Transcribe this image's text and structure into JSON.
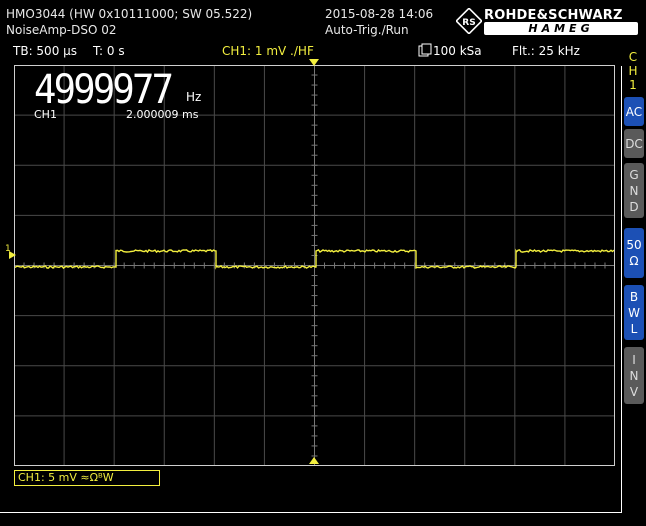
{
  "header": {
    "model": "HMO3044 (HW 0x10111000; SW 05.522)",
    "name": "NoiseAmp-DSO 02",
    "datetime": "2015-08-28 14:06",
    "trigger_mode": "Auto-Trig./Run",
    "brand": "ROHDE&SCHWARZ",
    "sub_brand": "HAMEG"
  },
  "status": {
    "timebase": "TB: 500 µs",
    "trigger_time": "T: 0 s",
    "channel_setting": "CH1: 1 mV ./HF",
    "sample_rate": "100 kSa",
    "filter": "Flt.: 25 kHz"
  },
  "measurement": {
    "frequency": "4999977",
    "frequency_unit": "Hz",
    "channel": "CH1",
    "period": "2.000009 ms"
  },
  "channel_box": "CH1: 5 mV ≈ΩᴮW",
  "marker": "1",
  "side_menu": {
    "channel_label": [
      "C",
      "H",
      "1"
    ],
    "keys": [
      {
        "label": [
          "AC"
        ],
        "state": "on"
      },
      {
        "label": [
          "DC"
        ],
        "state": "off"
      },
      {
        "label": [
          "G",
          "N",
          "D"
        ],
        "state": "off"
      },
      {
        "label": [
          "50",
          "Ω"
        ],
        "state": "on"
      },
      {
        "label": [
          "B",
          "W",
          "L"
        ],
        "state": "on"
      },
      {
        "label": [
          "I",
          "N",
          "V"
        ],
        "state": "off"
      }
    ]
  },
  "colors": {
    "trace": "#f3ef3f",
    "key_active": "#1c50b5",
    "key_inactive": "#5a5a5a"
  }
}
